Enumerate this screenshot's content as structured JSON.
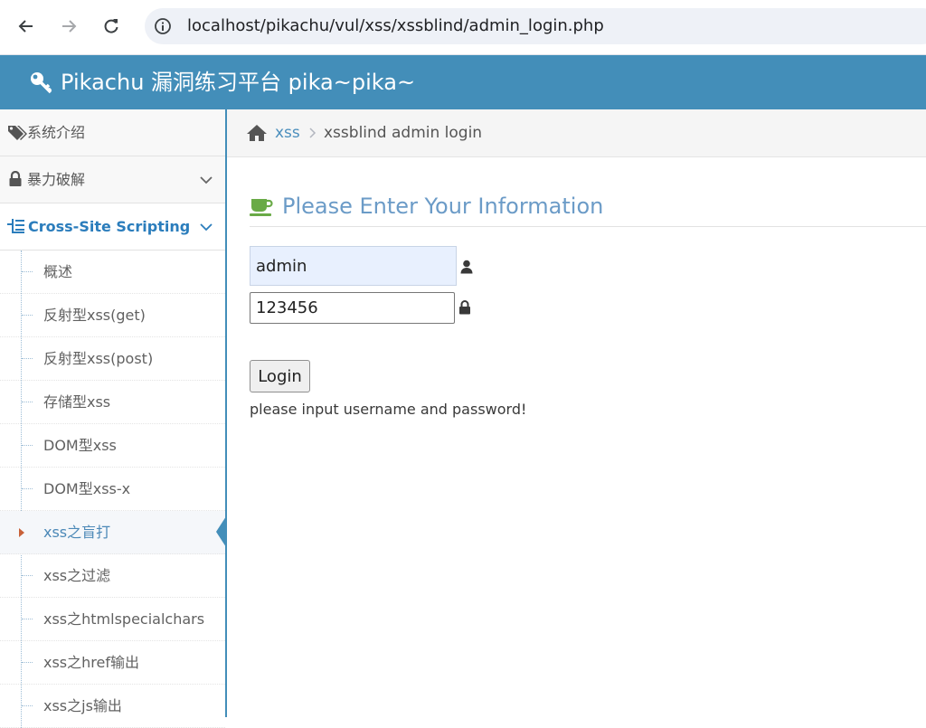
{
  "browser": {
    "url": "localhost/pikachu/vul/xss/xssblind/admin_login.php",
    "icons": [
      "back-arrow-icon",
      "forward-arrow-icon",
      "reload-icon",
      "site-info-icon"
    ]
  },
  "header": {
    "title": "Pikachu 漏洞练习平台 pika~pika~",
    "icon": "key-icon",
    "color": "#438eb9"
  },
  "sidebar": {
    "menus": [
      {
        "label": "系统介绍",
        "icon": "tags-icon"
      },
      {
        "label": "暴力破解",
        "icon": "lock-icon"
      },
      {
        "label": "Cross-Site Scripting",
        "icon": "list-tree-icon"
      }
    ],
    "xss_items": [
      "概述",
      "反射型xss(get)",
      "反射型xss(post)",
      "存储型xss",
      "DOM型xss",
      "DOM型xss-x",
      "xss之盲打",
      "xss之过滤",
      "xss之htmlspecialchars",
      "xss之href输出",
      "xss之js输出"
    ],
    "active_item": "xss之盲打"
  },
  "breadcrumbs": {
    "link": "xss",
    "current": "xssblind admin login"
  },
  "main": {
    "heading": "Please Enter Your Information",
    "username_value": "admin",
    "password_value": "123456",
    "login_label": "Login",
    "notice": "please input username and password!"
  }
}
